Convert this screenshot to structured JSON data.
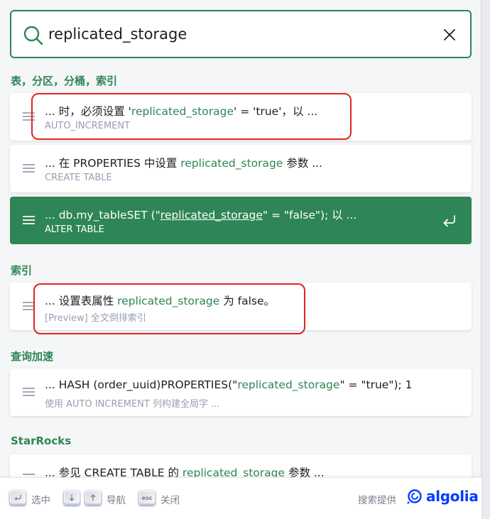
{
  "search": {
    "query": "replicated_storage"
  },
  "sections": [
    {
      "title": "表，分区，分桶，索引",
      "hits": [
        {
          "pre": "... 时，必须设置 '",
          "mark": "replicated_storage",
          "post": "' = 'true'，以 ...",
          "path": "AUTO_INCREMENT",
          "active": false
        },
        {
          "pre": "... 在 PROPERTIES 中设置 ",
          "mark": "replicated_storage",
          "post": " 参数 ...",
          "path": "CREATE TABLE",
          "active": false
        },
        {
          "pre": "... db.my_tableSET (\"",
          "mark": "replicated_storage",
          "post": "\" = \"false\"); 以 ...",
          "path": "ALTER TABLE",
          "active": true
        }
      ]
    },
    {
      "title": "索引",
      "hits": [
        {
          "pre": "... 设置表属性 ",
          "mark": "replicated_storage",
          "post": " 为 false。",
          "path": "[Preview] 全文倒排索引",
          "active": false
        }
      ]
    },
    {
      "title": "查询加速",
      "hits": [
        {
          "pre": "... HASH (order_uuid)PROPERTIES(\"",
          "mark": "replicated_storage",
          "post": "\" = \"true\"); 1",
          "path": "使用 AUTO INCREMENT 列构建全局字 ...",
          "active": false
        }
      ]
    },
    {
      "title": "StarRocks",
      "hits": [
        {
          "pre": "... 参见 CREATE TABLE 的 ",
          "mark": "replicated_storage",
          "post": " 参数 ...",
          "path": "",
          "active": false
        }
      ]
    }
  ],
  "footer": {
    "select_label": "选中",
    "navigate_label": "导航",
    "close_label": "关闭",
    "esc_key": "esc",
    "powered_by": "搜索提供",
    "brand": "algolia"
  },
  "colors": {
    "accent": "#2e8555",
    "annotation": "#e02424",
    "algolia": "#003dff"
  }
}
